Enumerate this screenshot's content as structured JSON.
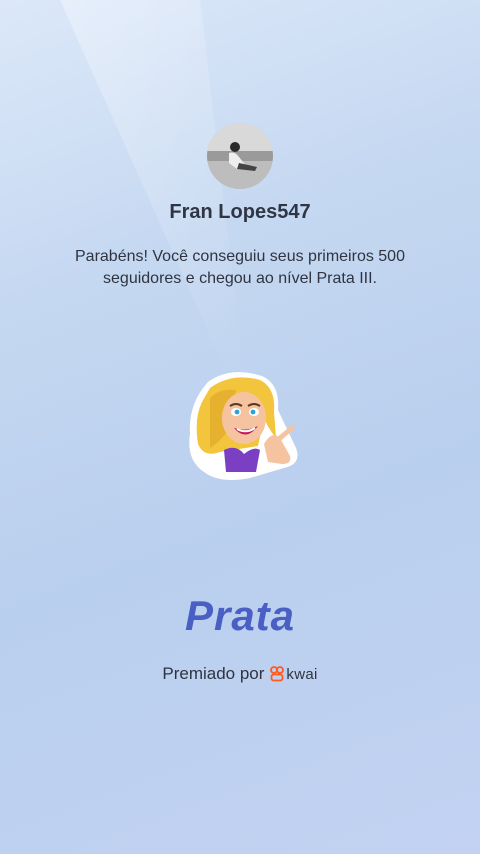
{
  "profile": {
    "username": "Fran Lopes547"
  },
  "message": {
    "text": "Parabéns! Você conseguiu seus primeiros 500 seguidores e chegou ao nível Prata III."
  },
  "level": {
    "name": "Prata"
  },
  "footer": {
    "awarded_by": "Premiado por",
    "brand": "kwai"
  },
  "colors": {
    "level_text": "#4a5fc4",
    "brand_icon": "#ff5a1f"
  }
}
